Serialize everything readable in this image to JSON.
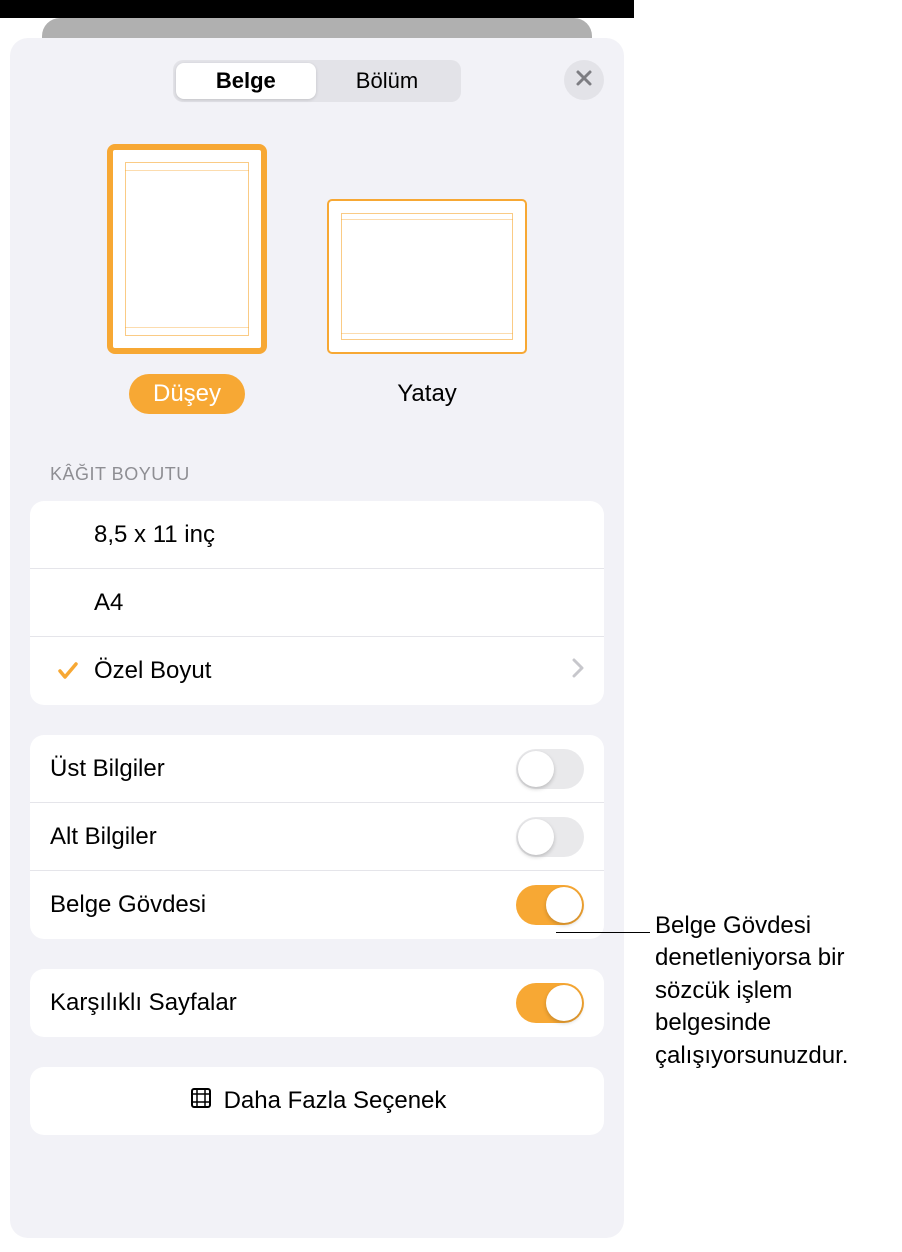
{
  "tabs": {
    "document": "Belge",
    "section": "Bölüm"
  },
  "orientation": {
    "portrait": "Düşey",
    "landscape": "Yatay"
  },
  "paper_size": {
    "title": "KÂĞIT BOYUTU",
    "options": [
      "8,5 x 11 inç",
      "A4",
      "Özel Boyut"
    ],
    "selected_index": 2
  },
  "toggles": {
    "headers": {
      "label": "Üst Bilgiler",
      "on": false
    },
    "footers": {
      "label": "Alt Bilgiler",
      "on": false
    },
    "body": {
      "label": "Belge Gövdesi",
      "on": true
    },
    "facing": {
      "label": "Karşılıklı Sayfalar",
      "on": true
    }
  },
  "more_options": "Daha Fazla Seçenek",
  "callout": "Belge Gövdesi denetleniyorsa bir sözcük işlem belgesinde çalışıyorsunuzdur.",
  "colors": {
    "accent": "#f7a834"
  }
}
